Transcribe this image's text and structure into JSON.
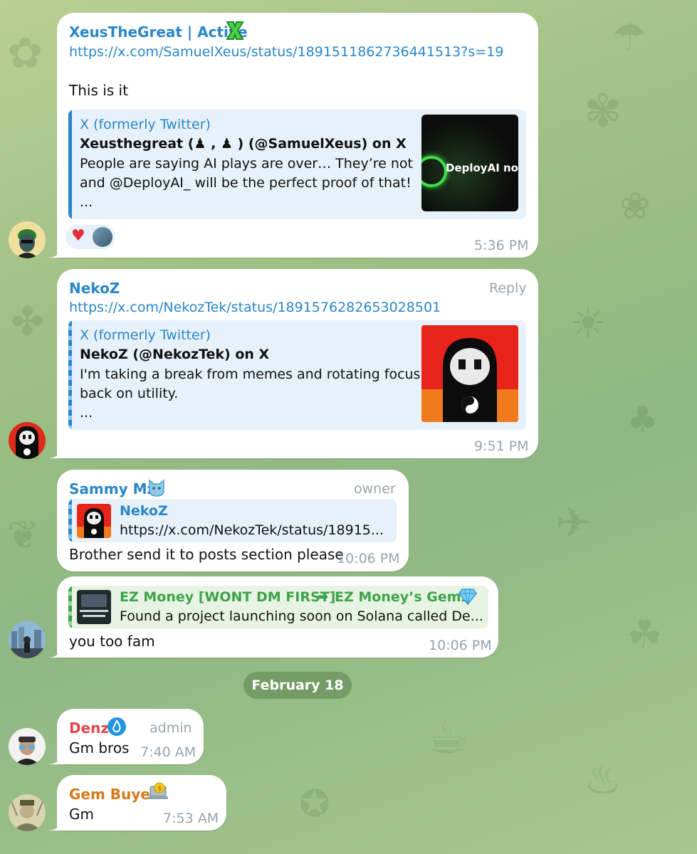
{
  "colors": {
    "link": "#2a86c9",
    "xeus_name": "#2a86c9",
    "nekoz_name": "#2a86c9",
    "sammy_name": "#2a86c9",
    "ezmoney_name": "#3ea34a",
    "denz_name": "#e0474c",
    "gembuyer_name": "#d87a1a",
    "date_pill": "#6b9160"
  },
  "messages": [
    {
      "sender": "XeusTheGreat | Active",
      "sender_badge_icon": "green-x-emoji-icon",
      "link": "https://x.com/SamuelXeus/status/1891511862736441513?s=19",
      "text": "This is it",
      "preview": {
        "site": "X (formerly Twitter)",
        "title": "Xeusthegreat (♟ , ♟ ) (@SamuelXeus) on X",
        "desc_line1": "People are saying AI plays are over… They’re not",
        "desc_line2": "and @DeployAI_ will be the perfect proof of that!",
        "desc_line3": "...",
        "thumb_text": "DeployAI now"
      },
      "reactions": [
        "heart-icon",
        "reactor-avatar"
      ],
      "time": "5:36 PM"
    },
    {
      "sender": "NekoZ",
      "role": "Reply",
      "link": "https://x.com/NekozTek/status/1891576282653028501",
      "preview": {
        "site": "X (formerly Twitter)",
        "title": "NekoZ (@NekozTek) on X",
        "desc_line1": "I'm taking a break from memes and rotating focus",
        "desc_line2": "back on utility.",
        "desc_line3": "..."
      },
      "time": "9:51 PM"
    },
    {
      "sender": "Sammy Mz",
      "sender_badge_icon": "blue-cat-emoji-icon",
      "role": "owner",
      "reply_to": {
        "name": "NekoZ",
        "text": "https://x.com/NekozTek/status/18915..."
      },
      "text": "Brother send it to posts section please",
      "time": "10:06 PM"
    },
    {
      "reply_to": {
        "name": "EZ Money [WONT DM FIRST]",
        "forward_target": "EZ Money’s Gems",
        "forward_badge_icon": "diamond-icon",
        "text": "Found a project launching soon on Solana called De..."
      },
      "text": "you too fam",
      "time": "10:06 PM"
    },
    {
      "sender": "Denz",
      "sender_badge_icon": "water-drop-badge-icon",
      "role": "admin",
      "text": "Gm bros",
      "time": "7:40 AM"
    },
    {
      "sender": "Gem Buyer",
      "sender_badge_icon": "laptop-coin-emoji-icon",
      "text": "Gm",
      "time": "7:53 AM"
    }
  ],
  "date_separator": "February 18"
}
